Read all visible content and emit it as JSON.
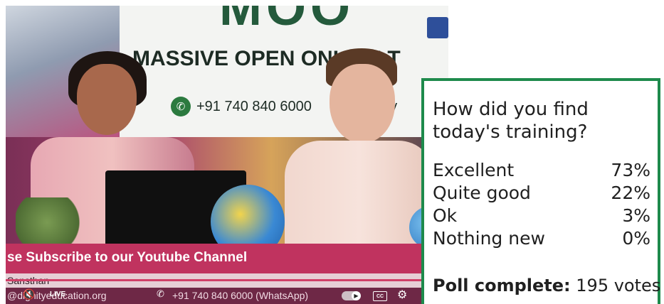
{
  "video": {
    "banner_title": "MASSIVE OPEN ONLINE T",
    "banner_logo_text": "MOO",
    "banner_phone": "+91 740 840 6000",
    "banner_phone_suffix": "gnity",
    "ticker": "se Subscribe to our Youtube Channel",
    "subbar": "Sansthan",
    "controls": {
      "live_label": "LIVE",
      "email": "@dignityeducation.org",
      "phone": "+91 740 840 6000  (WhatsApp)"
    },
    "icons": {
      "mute": "mute-icon",
      "autoplay": "autoplay-toggle-icon",
      "captions": "captions-icon",
      "settings": "gear-icon",
      "phone": "phone-icon"
    }
  },
  "poll": {
    "question": "How did you find today's training?",
    "options": [
      {
        "label": "Excellent",
        "percent": "73%"
      },
      {
        "label": "Quite good",
        "percent": "22%"
      },
      {
        "label": "Ok",
        "percent": "3%"
      },
      {
        "label": "Nothing new",
        "percent": "0%"
      }
    ],
    "status_label": "Poll complete:",
    "votes": "195 votes",
    "accent": "#1e8a4c"
  }
}
